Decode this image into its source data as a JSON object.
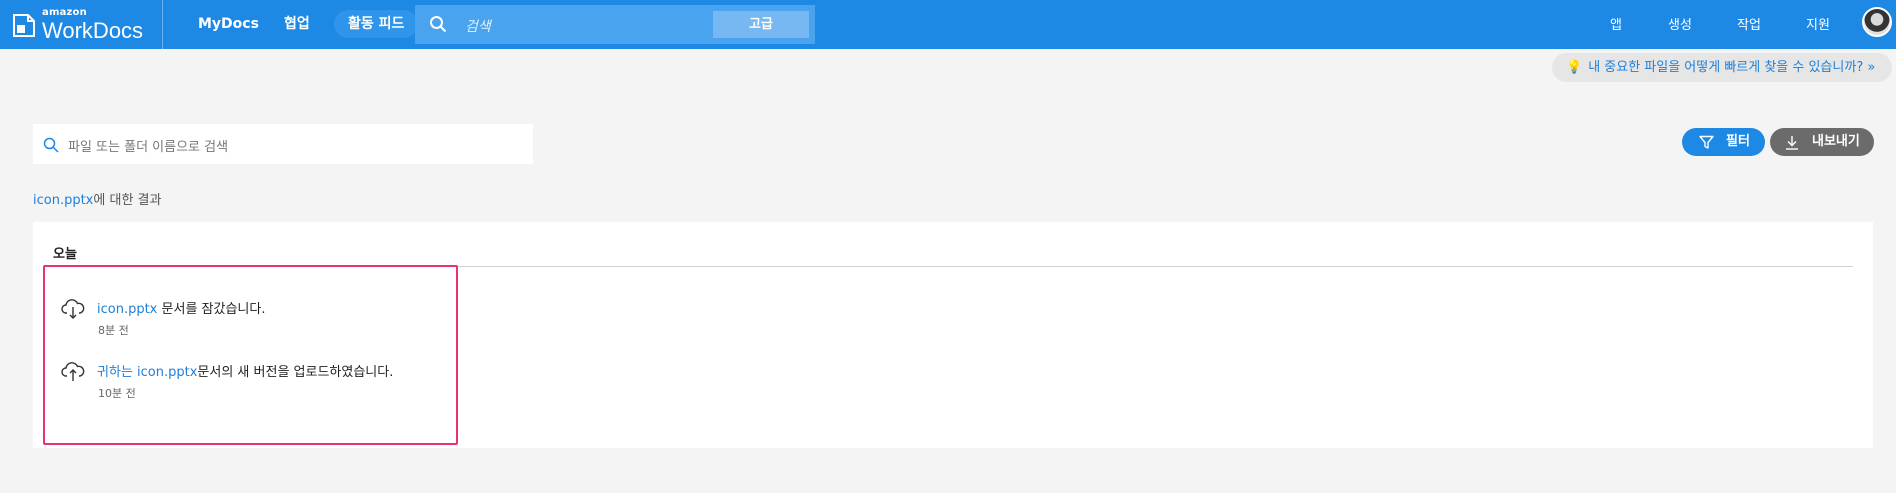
{
  "header": {
    "logo_small": "amazon",
    "logo_big": "WorkDocs",
    "nav": {
      "mydocs": "MyDocs",
      "collab": "협업",
      "feed": "활동 피드"
    },
    "search": {
      "placeholder": "검색",
      "advanced": "고급"
    },
    "right_nav": {
      "app": "앱",
      "create": "생성",
      "work": "작업",
      "support": "지원"
    }
  },
  "tip": "내 중요한 파일을 어떻게 빠르게 찾을 수 있습니까? »",
  "file_search_placeholder": "파일 또는 폴더 이름으로 검색",
  "buttons": {
    "filter": "필터",
    "export": "내보내기"
  },
  "results_for": {
    "query": "icon.pptx",
    "suffix": "에 대한 결과"
  },
  "group_title": "오늘",
  "activities": [
    {
      "icon": "cloud-download-icon",
      "file": "icon.pptx",
      "text": " 문서를 잠갔습니다.",
      "time": "8분 전"
    },
    {
      "icon": "cloud-upload-icon",
      "user": "귀하는",
      "file": "icon.pptx",
      "text": "문서의 새 버전을 업로드하였습니다.",
      "time": "10분 전"
    }
  ],
  "colors": {
    "brand_blue": "#1e88e5",
    "link_blue": "#1e7fd8",
    "highlight_border": "#e8336f"
  }
}
